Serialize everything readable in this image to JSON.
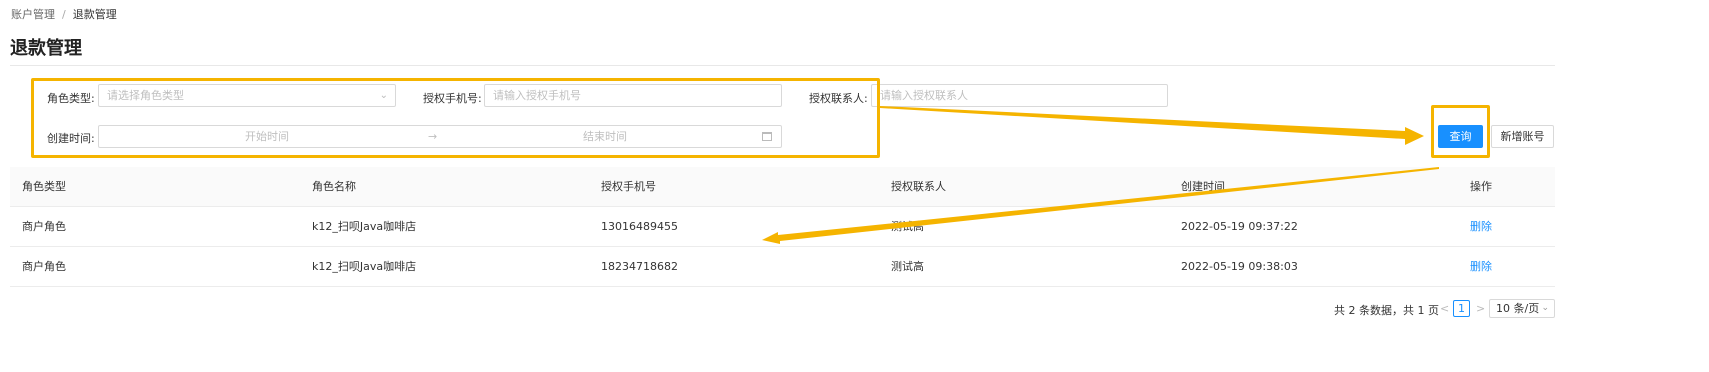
{
  "breadcrumb": {
    "parent": "账户管理",
    "separator": "/",
    "current": "退款管理"
  },
  "page_title": "退款管理",
  "filters": {
    "role_type_label": "角色类型:",
    "role_type_placeholder": "请选择角色类型",
    "auth_phone_label": "授权手机号:",
    "auth_phone_placeholder": "请输入授权手机号",
    "auth_contact_label": "授权联系人:",
    "auth_contact_placeholder": "请输入授权联系人",
    "created_label": "创建时间:",
    "start_placeholder": "开始时间",
    "end_placeholder": "结束时间",
    "range_arrow": "→"
  },
  "actions": {
    "query_label": "查询",
    "add_label": "新增账号"
  },
  "table": {
    "headers": [
      "角色类型",
      "角色名称",
      "授权手机号",
      "授权联系人",
      "创建时间",
      "操作"
    ],
    "rows": [
      {
        "role_type": "商户角色",
        "role_name": "k12_扫呗Java咖啡店",
        "phone": "13016489455",
        "contact": "测试高",
        "created": "2022-05-19 09:37:22",
        "action": "删除"
      },
      {
        "role_type": "商户角色",
        "role_name": "k12_扫呗Java咖啡店",
        "phone": "18234718682",
        "contact": "测试高",
        "created": "2022-05-19 09:38:03",
        "action": "删除"
      }
    ]
  },
  "pagination": {
    "total_text": "共 2 条数据，共 1 页",
    "prev": "<",
    "current_page": "1",
    "next": ">",
    "page_size": "10 条/页"
  },
  "colors": {
    "primary": "#1890ff",
    "highlight": "#f5b400"
  },
  "icons": [
    "chevron-down-icon",
    "calendar-icon",
    "arrow-right-icon"
  ]
}
